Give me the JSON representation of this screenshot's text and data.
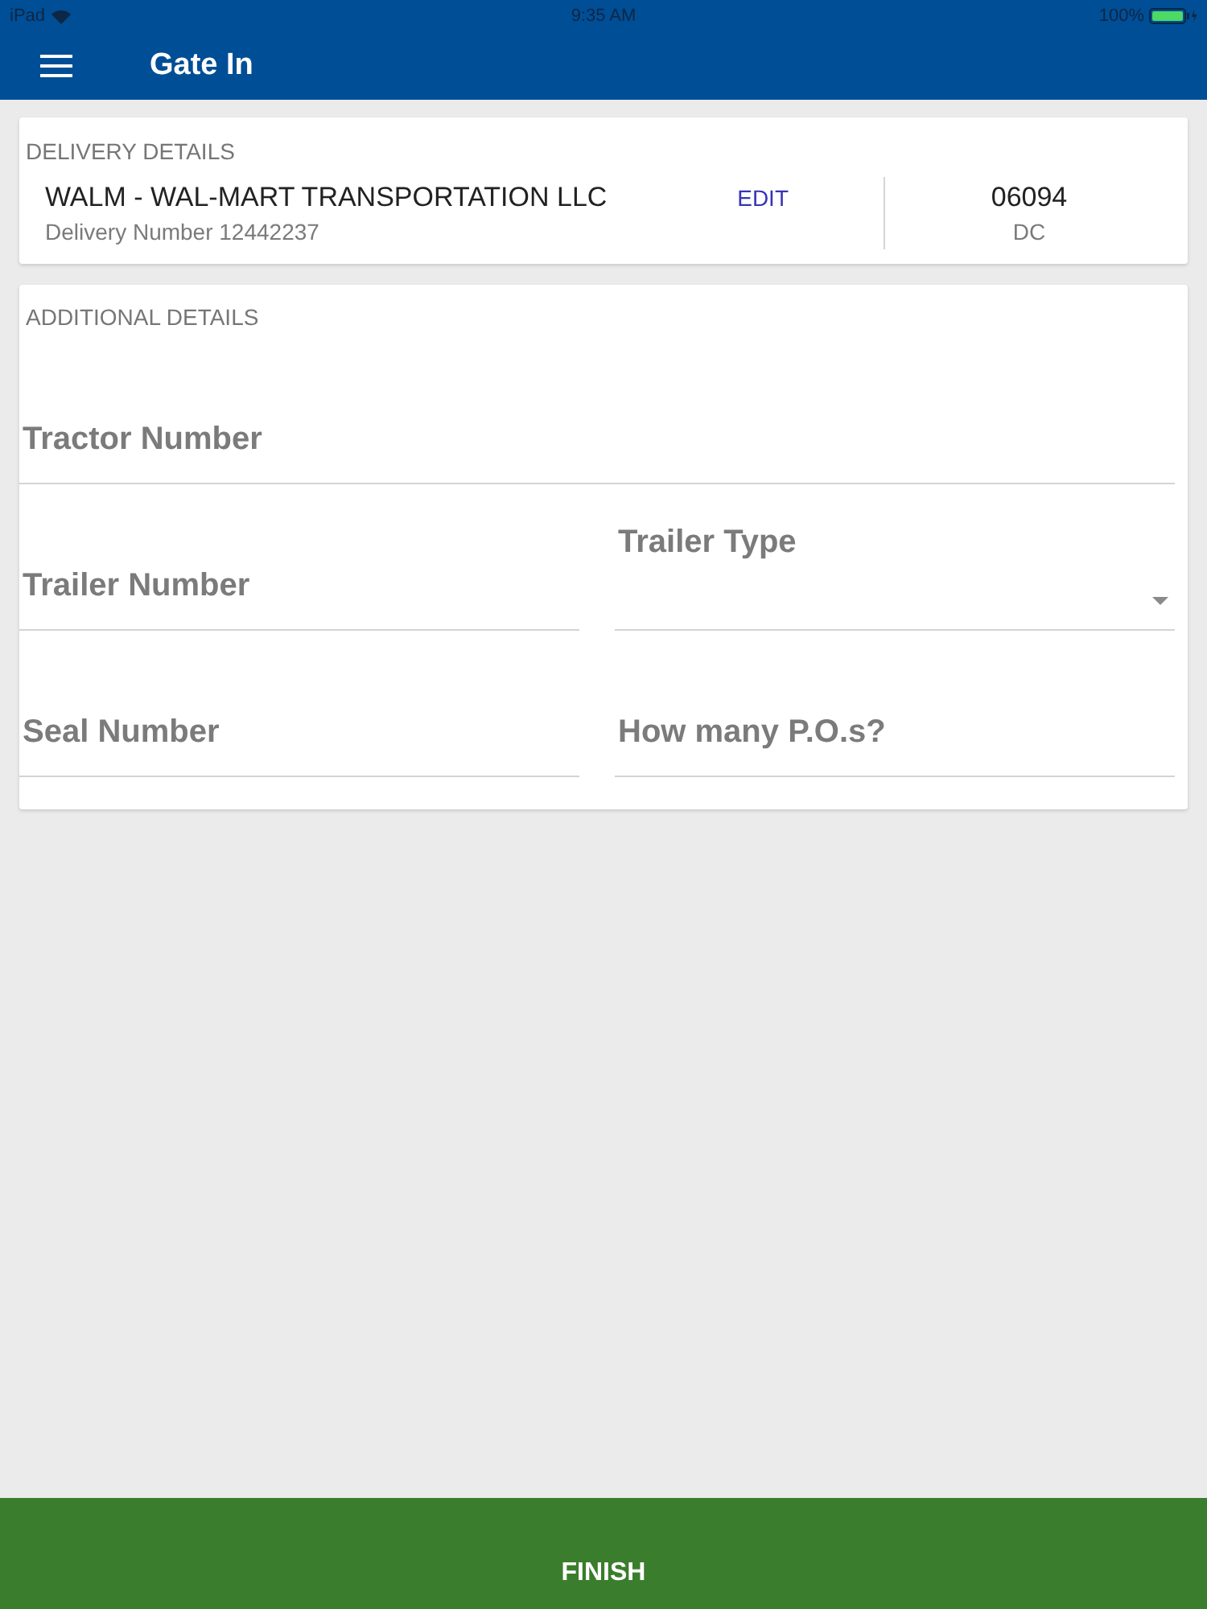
{
  "status_bar": {
    "device": "iPad",
    "time": "9:35 AM",
    "battery": "100%"
  },
  "header": {
    "title": "Gate In"
  },
  "delivery_details": {
    "heading": "DELIVERY DETAILS",
    "carrier": "WALM - WAL-MART TRANSPORTATION LLC",
    "delivery_number": "Delivery Number 12442237",
    "edit": "EDIT",
    "code": "06094",
    "code_label": "DC"
  },
  "additional_details": {
    "heading": "ADDITIONAL DETAILS",
    "rows": [
      [
        {
          "kind": "text",
          "placeholder": "Tractor Number"
        }
      ],
      [
        {
          "kind": "text",
          "placeholder": "Trailer Number"
        },
        {
          "kind": "select",
          "label": "Trailer Type"
        }
      ],
      [
        {
          "kind": "text",
          "placeholder": "Seal Number"
        },
        {
          "kind": "text",
          "placeholder": "How many P.O.s?"
        }
      ]
    ]
  },
  "finish_button": {
    "label": "FINISH"
  }
}
